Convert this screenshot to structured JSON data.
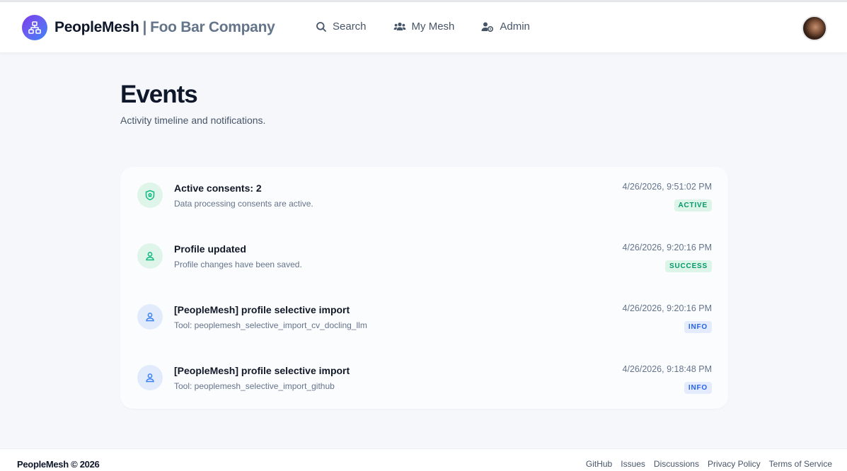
{
  "header": {
    "brand_name": "PeopleMesh",
    "brand_separator": "|",
    "org_name": "Foo Bar Company",
    "nav": [
      {
        "label": "Search",
        "icon": "search-icon"
      },
      {
        "label": "My Mesh",
        "icon": "users-icon"
      },
      {
        "label": "Admin",
        "icon": "user-cog-icon"
      }
    ]
  },
  "page": {
    "title": "Events",
    "subtitle": "Activity timeline and notifications."
  },
  "events": [
    {
      "title": "Active consents: 2",
      "description": "Data processing consents are active.",
      "time": "4/26/2026, 9:51:02 PM",
      "badge": "ACTIVE",
      "icon": "shield-icon",
      "color": "#059669"
    },
    {
      "title": "Profile updated",
      "description": "Profile changes have been saved.",
      "time": "4/26/2026, 9:20:16 PM",
      "badge": "SUCCESS",
      "icon": "user-icon",
      "color": "#059669"
    },
    {
      "title": "[PeopleMesh] profile selective import",
      "description": "Tool: peoplemesh_selective_import_cv_docling_llm",
      "time": "4/26/2026, 9:20:16 PM",
      "badge": "INFO",
      "icon": "user-icon",
      "color": "#2563eb"
    },
    {
      "title": "[PeopleMesh] profile selective import",
      "description": "Tool: peoplemesh_selective_import_github",
      "time": "4/26/2026, 9:18:48 PM",
      "badge": "INFO",
      "icon": "user-icon",
      "color": "#2563eb"
    }
  ],
  "footer": {
    "brand": "PeopleMesh © 2026",
    "links": [
      "GitHub",
      "Issues",
      "Discussions",
      "Privacy Policy",
      "Terms of Service"
    ]
  }
}
